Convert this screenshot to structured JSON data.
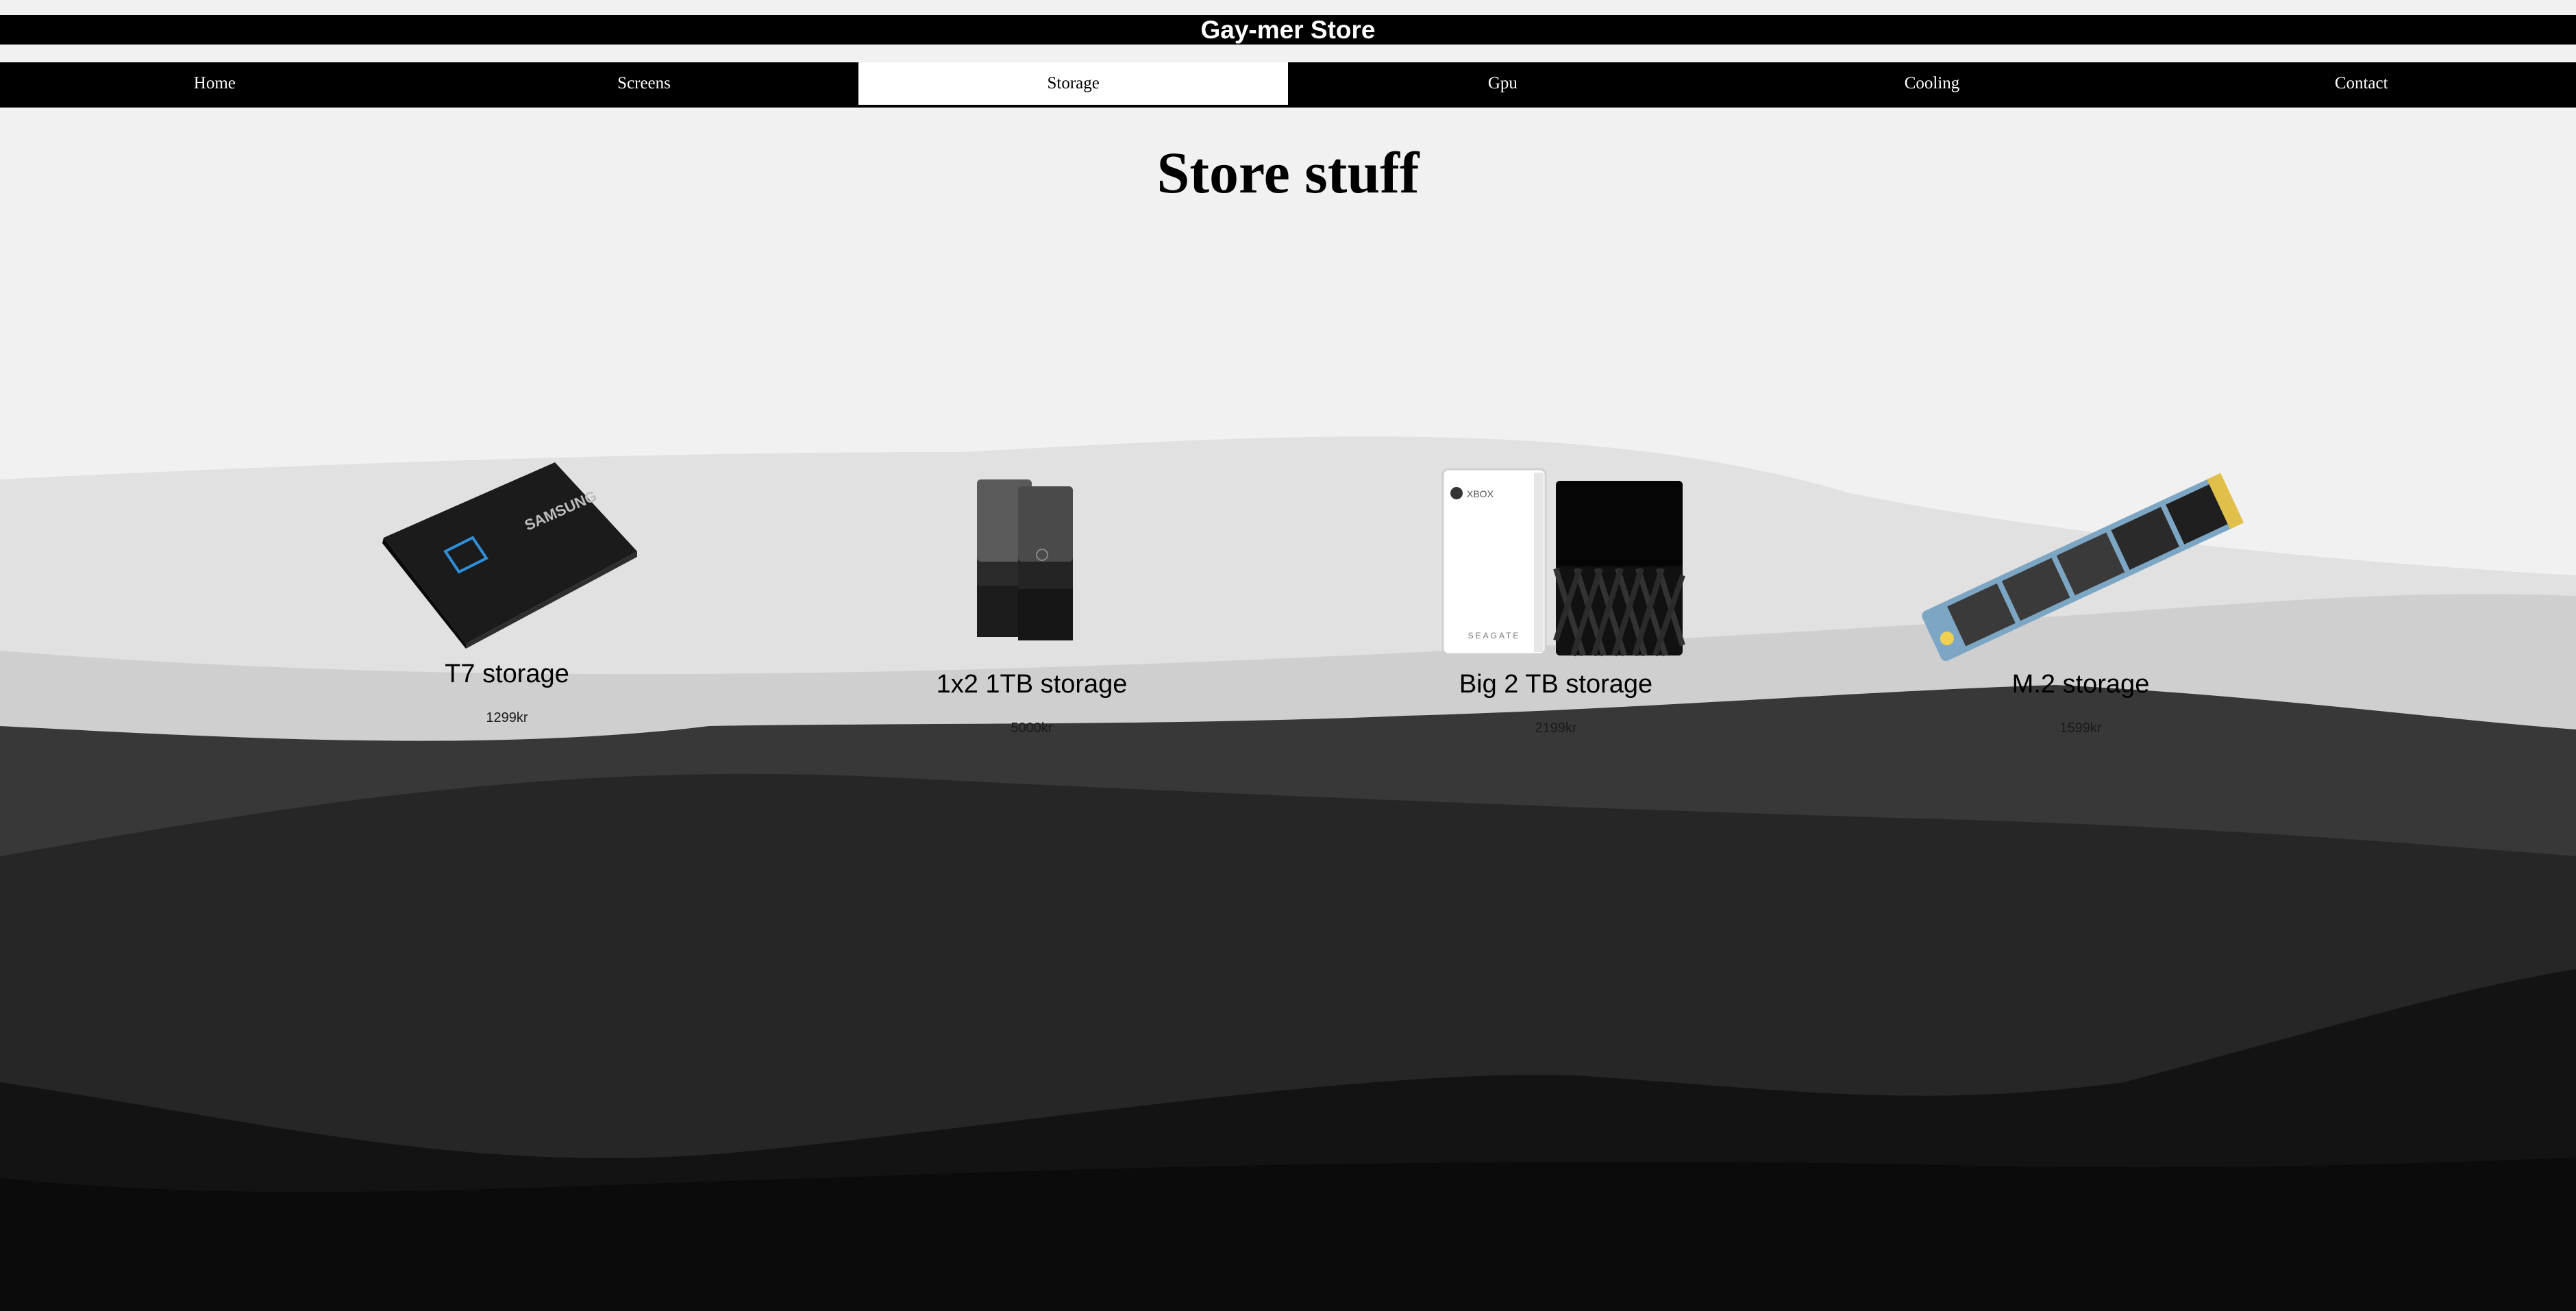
{
  "header": {
    "title": "Gay-mer Store"
  },
  "nav": {
    "items": [
      {
        "label": "Home"
      },
      {
        "label": "Screens"
      },
      {
        "label": "Storage"
      },
      {
        "label": "Gpu"
      },
      {
        "label": "Cooling"
      },
      {
        "label": "Contact"
      }
    ],
    "active": "Storage"
  },
  "main": {
    "title": "Store stuff",
    "products": [
      {
        "name": "T7 storage",
        "price": "1299kr"
      },
      {
        "name": "1x2 1TB storage",
        "price": "5000kr"
      },
      {
        "name": "Big 2 TB storage",
        "price": "2199kr"
      },
      {
        "name": "M.2 storage",
        "price": "1599kr"
      }
    ]
  },
  "product_images": {
    "samsung_brand": "SAMSUNG",
    "xbox_brand": "XBOX",
    "seagate_brand": "SEAGATE"
  },
  "colors": {
    "header_bg": "#000000",
    "page_bg": "#f1f1f1",
    "active_tab_bg": "#ffffff"
  }
}
